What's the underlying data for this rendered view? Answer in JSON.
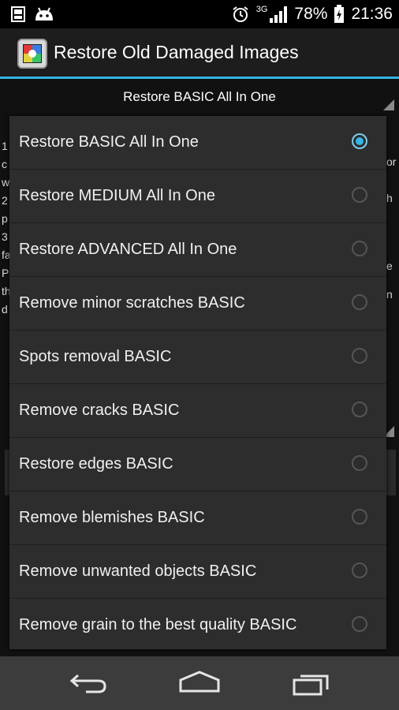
{
  "status_bar": {
    "network": "3G",
    "battery": "78%",
    "time": "21:36",
    "icons": [
      "gallery-notification-icon",
      "android-notification-icon",
      "alarm-icon",
      "signal-icon",
      "battery-charging-icon"
    ]
  },
  "action_bar": {
    "title": "Restore Old Damaged Images",
    "icon": "app-icon"
  },
  "spinner": {
    "selected": "Restore BASIC All In One"
  },
  "background_text": {
    "left": [
      "1",
      "c",
      "w",
      "2",
      "p",
      "3",
      "fa",
      "P",
      "th",
      "d"
    ],
    "right": [
      "or",
      "h",
      "e",
      "n"
    ]
  },
  "dropdown": {
    "options": [
      {
        "label": "Restore BASIC All In One",
        "selected": true
      },
      {
        "label": "Restore MEDIUM All In One",
        "selected": false
      },
      {
        "label": "Restore ADVANCED All In One",
        "selected": false
      },
      {
        "label": "Remove minor scratches BASIC",
        "selected": false
      },
      {
        "label": "Spots removal BASIC",
        "selected": false
      },
      {
        "label": "Remove cracks BASIC",
        "selected": false
      },
      {
        "label": "Restore edges BASIC",
        "selected": false
      },
      {
        "label": "Remove blemishes BASIC",
        "selected": false
      },
      {
        "label": "Remove unwanted objects BASIC",
        "selected": false
      },
      {
        "label": "Remove grain to the best quality BASIC",
        "selected": false
      }
    ]
  },
  "nav_bar": {
    "buttons": [
      "back-icon",
      "home-icon",
      "recent-apps-icon"
    ]
  },
  "colors": {
    "accent": "#33b5e5",
    "dropdown_bg": "#2d2d2d",
    "nav_bg": "#3c3c3c"
  }
}
